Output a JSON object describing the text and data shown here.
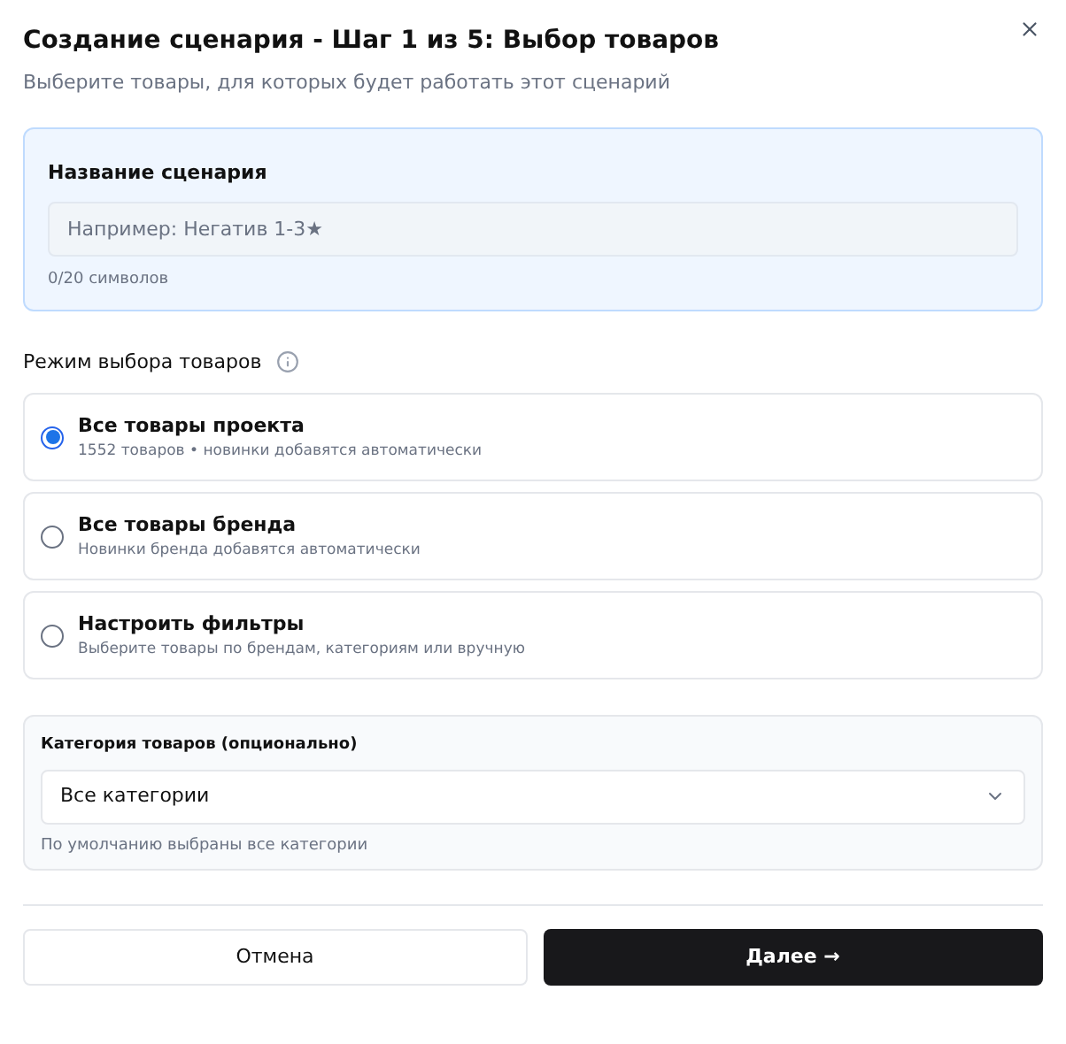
{
  "dialog": {
    "title": "Создание сценария - Шаг 1 из 5: Выбор товаров",
    "subtitle": "Выберите товары, для которых будет работать этот сценарий"
  },
  "name_field": {
    "label": "Название сценария",
    "placeholder": "Например: Негатив 1-3★",
    "counter": "0/20 символов"
  },
  "mode": {
    "label": "Режим выбора товаров",
    "options": [
      {
        "title": "Все товары проекта",
        "description": "1552 товаров • новинки добавятся автоматически",
        "selected": true
      },
      {
        "title": "Все товары бренда",
        "description": "Новинки бренда добавятся автоматически",
        "selected": false
      },
      {
        "title": "Настроить фильтры",
        "description": "Выберите товары по брендам, категориям или вручную",
        "selected": false
      }
    ]
  },
  "category": {
    "label": "Категория товаров (опционально)",
    "value": "Все категории",
    "hint": "По умолчанию выбраны все категории"
  },
  "buttons": {
    "cancel": "Отмена",
    "next": "Далее →"
  }
}
